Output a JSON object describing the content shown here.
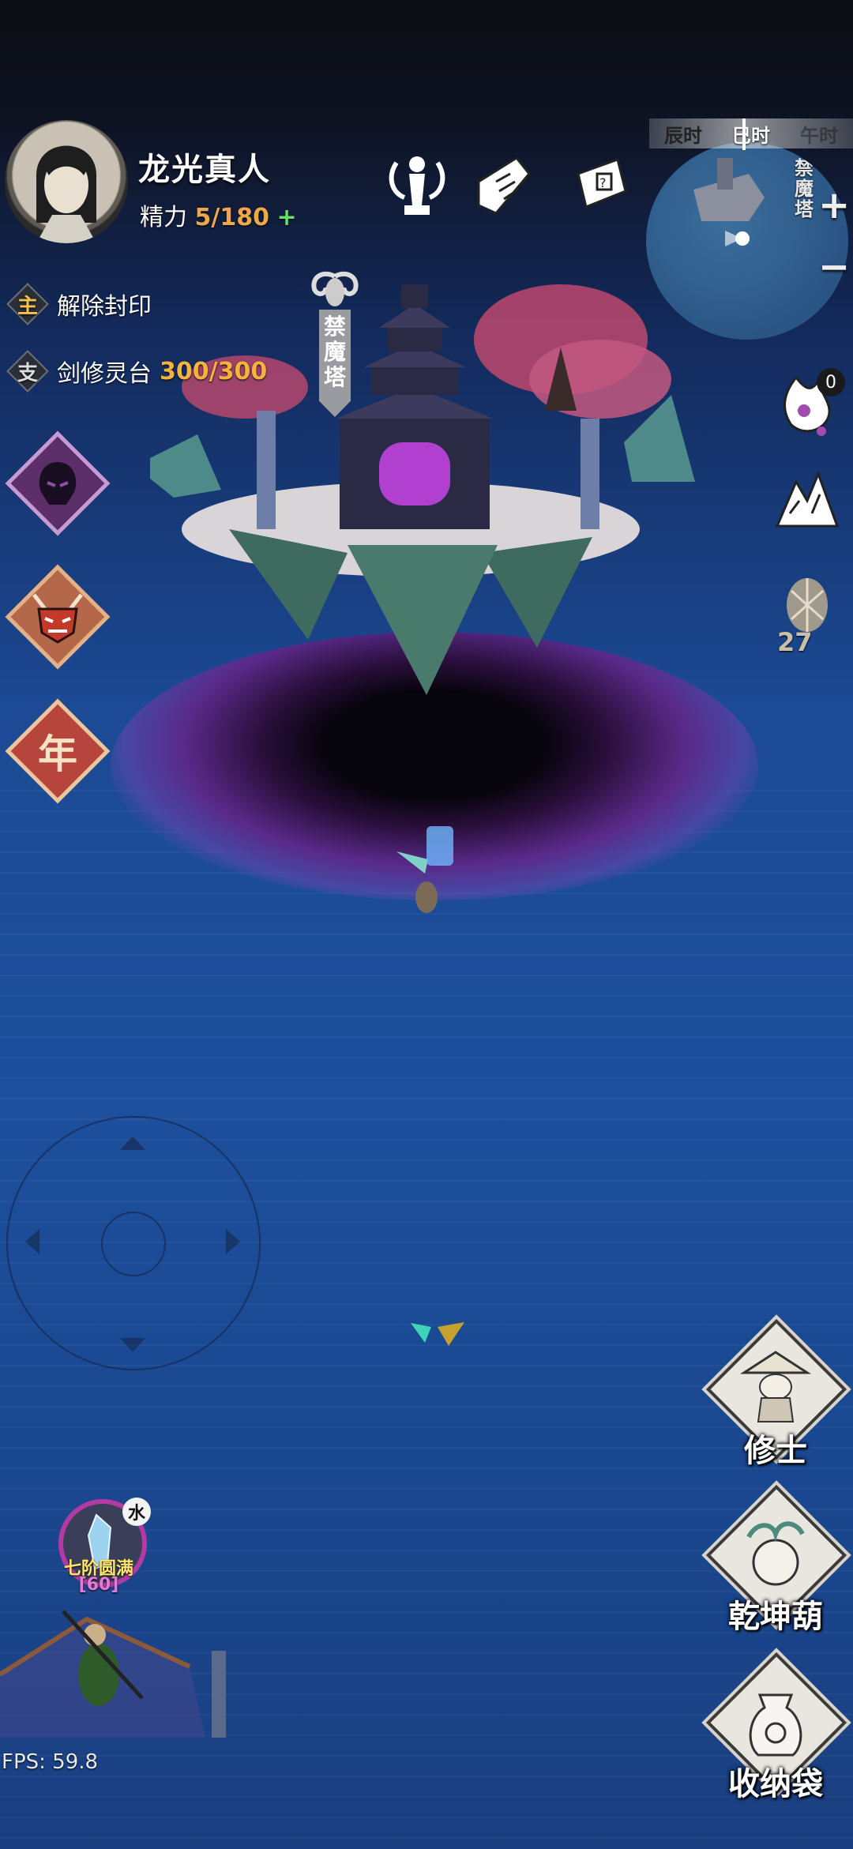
{
  "player": {
    "name": "龙光真人",
    "stamina_label": "精力",
    "stamina_value": "5/180",
    "stamina_plus": "+"
  },
  "quests": [
    {
      "tag": "主",
      "text": "解除封印",
      "progress": ""
    },
    {
      "tag": "支",
      "text": "剑修灵台",
      "progress": "300/300"
    }
  ],
  "event_buttons": [
    {
      "icon": "demon-shadow-icon"
    },
    {
      "icon": "demon-mask-icon"
    },
    {
      "icon": "new-year-icon",
      "glyph": "年"
    }
  ],
  "time_bar": [
    "辰时",
    "巳时",
    "午时"
  ],
  "minimap": {
    "location": "禁魔塔",
    "zoom_in": "+",
    "zoom_out": "−"
  },
  "map_label": "禁魔塔",
  "side_icons": [
    {
      "icon": "spirit-flame-icon",
      "count": "0"
    },
    {
      "icon": "mountain-icon"
    },
    {
      "icon": "spirit-orb-icon",
      "count": "27"
    }
  ],
  "actions": [
    {
      "label": "修士",
      "icon": "cultivator-icon"
    },
    {
      "label": "乾坤葫",
      "icon": "gourd-icon"
    },
    {
      "label": "收纳袋",
      "icon": "storage-bag-icon"
    }
  ],
  "realm": {
    "element": "水",
    "stage": "七阶圆满",
    "level": "[60]"
  },
  "fps": "FPS: 59.8",
  "colors": {
    "stamina_value": "#f0a64a",
    "plus": "#5fe36e",
    "quest_progress": "#f5b33e",
    "realm_stage": "#ffe56a",
    "realm_level": "#e27ad8"
  }
}
